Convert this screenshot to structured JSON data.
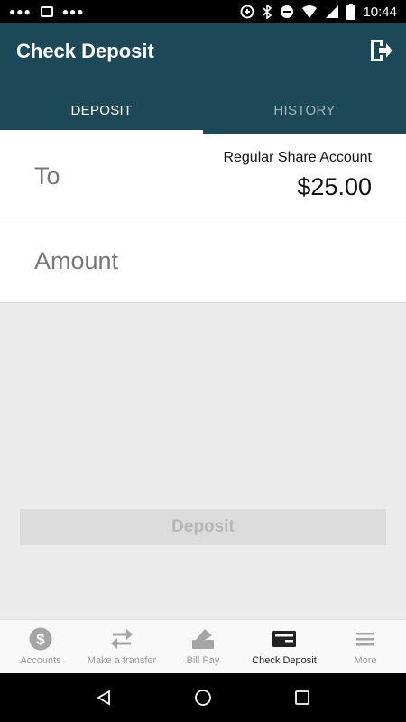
{
  "status_bar": {
    "time": "10:44"
  },
  "app_bar": {
    "title": "Check Deposit"
  },
  "tabs": [
    {
      "label": "DEPOSIT",
      "active": true
    },
    {
      "label": "HISTORY",
      "active": false
    }
  ],
  "to_row": {
    "label": "To",
    "account_name": "Regular Share Account",
    "balance": "$25.00"
  },
  "amount_row": {
    "label": "Amount"
  },
  "deposit_button": {
    "label": "Deposit"
  },
  "bottom_nav": [
    {
      "label": "Accounts",
      "icon": "dollar-circle-icon"
    },
    {
      "label": "Make a transfer",
      "icon": "transfer-arrows-icon"
    },
    {
      "label": "Bill Pay",
      "icon": "bill-pay-icon"
    },
    {
      "label": "Check Deposit",
      "icon": "check-card-icon",
      "active": true
    },
    {
      "label": "More",
      "icon": "menu-icon"
    }
  ],
  "colors": {
    "primary": "#1c4858",
    "tab_inactive": "#9fb6bf",
    "background": "#ebebeb"
  }
}
